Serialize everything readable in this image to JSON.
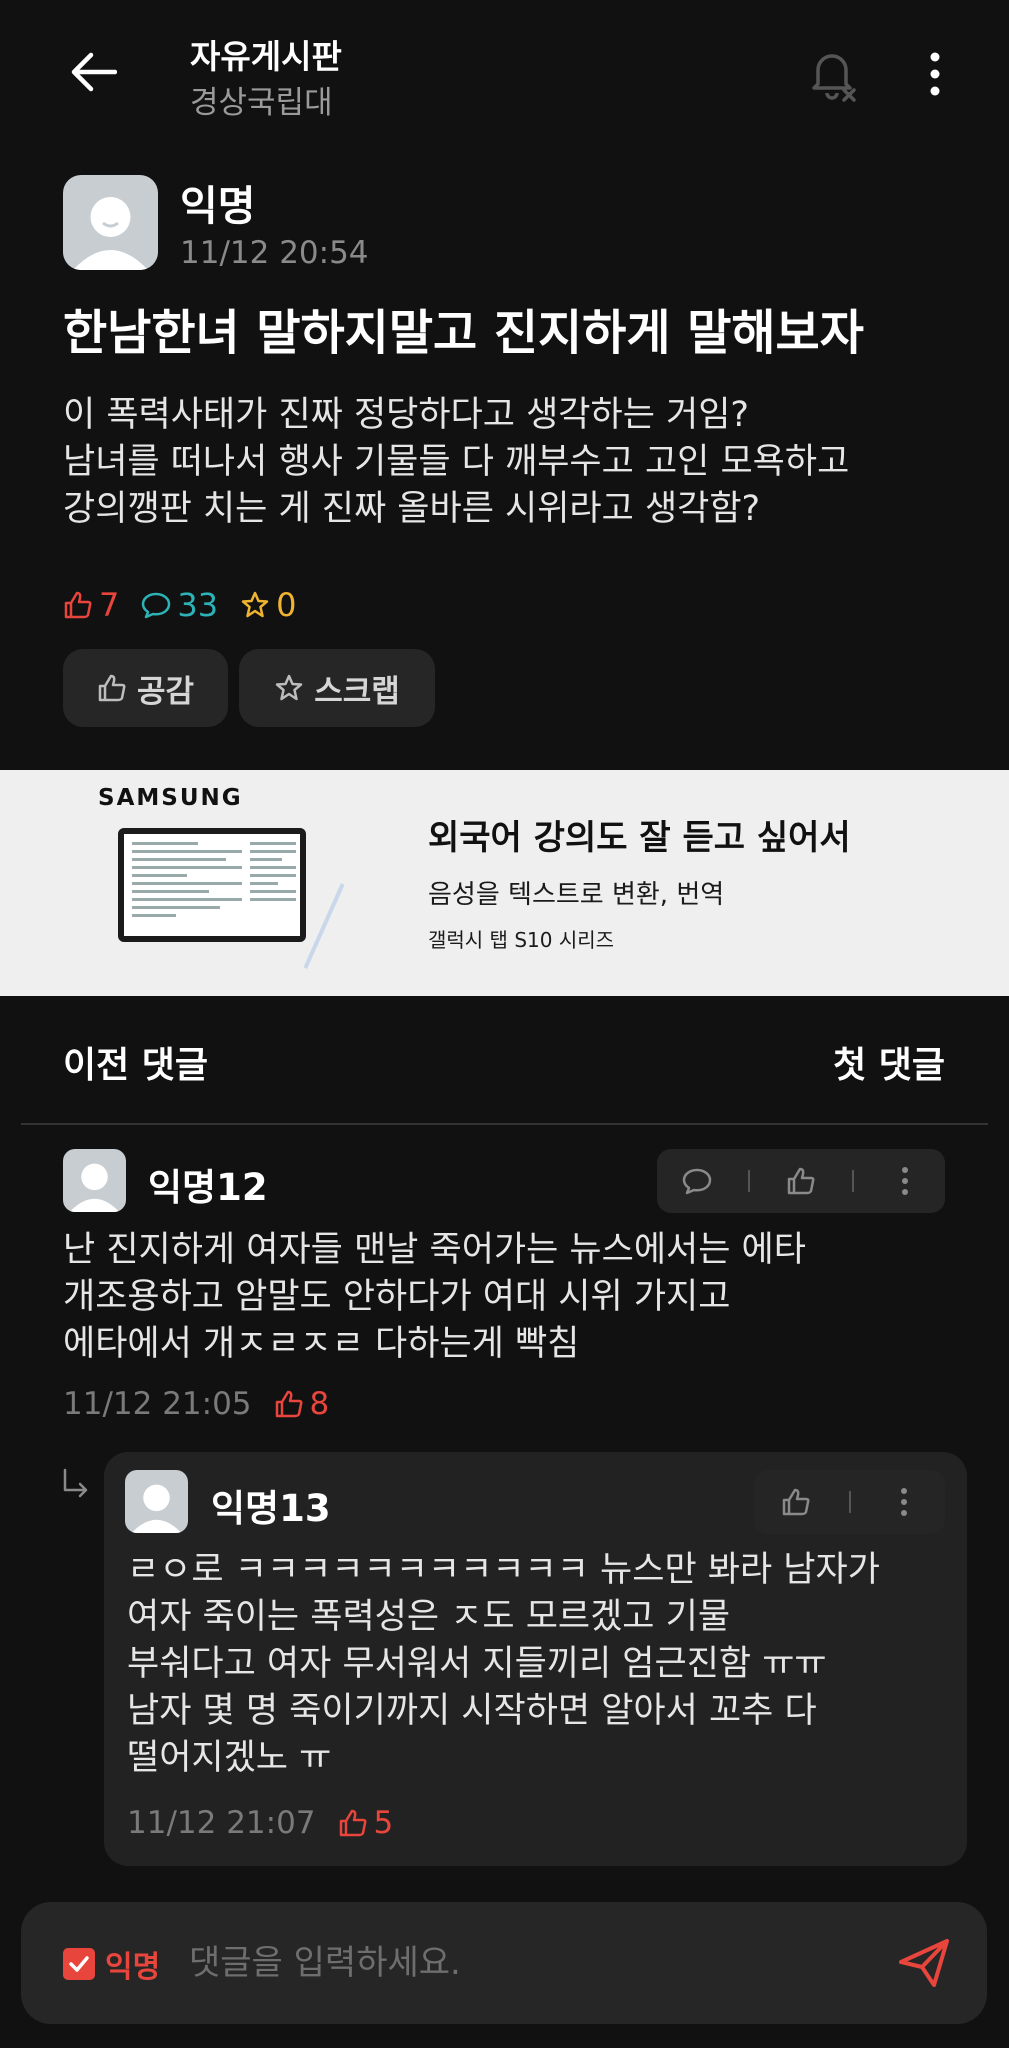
{
  "header": {
    "title": "자유게시판",
    "subtitle": "경상국립대",
    "back_icon": "back-arrow-icon",
    "bell_icon": "bell-off-icon",
    "more_icon": "more-vertical-icon"
  },
  "post": {
    "author": "익명",
    "time": "11/12 20:54",
    "title": "한남한녀 말하지말고 진지하게 말해보자",
    "body_lines": [
      "이 폭력사태가 진짜 정당하다고 생각하는 거임?",
      "남녀를 떠나서 행사 기물들 다 깨부수고 고인 모욕하고",
      "강의깽판 치는 게 진짜 올바른 시위라고 생각함?"
    ],
    "stats": {
      "likes": "7",
      "comments": "33",
      "scraps": "0"
    },
    "buttons": {
      "like": "공감",
      "scrap": "스크랩"
    }
  },
  "ad": {
    "brand": "SAMSUNG",
    "headline": "외국어 강의도 잘 듣고 싶어서",
    "line2": "음성을 텍스트로 변환, 번역",
    "line3": "갤럭시 탭 S10 시리즈"
  },
  "comment_nav": {
    "prev": "이전 댓글",
    "first": "첫 댓글"
  },
  "comments": [
    {
      "author": "익명12",
      "lines": [
        "난 진지하게 여자들 맨날 죽어가는 뉴스에서는 에타",
        "개조용하고 암말도 안하다가 여대 시위 가지고",
        "에타에서 개ㅈㄹㅈㄹ 다하는게 빡침"
      ],
      "time": "11/12 21:05",
      "likes": "8"
    },
    {
      "author": "익명13",
      "lines": [
        "ㄹㅇ로 ㅋㅋㅋㅋㅋㅋㅋㅋㅋㅋㅋ 뉴스만 봐라 남자가",
        "여자 죽이는 폭력성은 ㅈ도 모르겠고 기물",
        "부숴다고 여자 무서워서 지들끼리 엄근진함 ㅠㅠ",
        "남자 몇 명 죽이기까지 시작하면 알아서 꼬추 다",
        "떨어지겠노 ㅠ"
      ],
      "time": "11/12 21:07",
      "likes": "5"
    }
  ],
  "input": {
    "anon_label": "익명",
    "anon_checked": true,
    "placeholder": "댓글을 입력하세요.",
    "value": ""
  },
  "colors": {
    "background": "#111111",
    "accent_red": "#e8453c",
    "comment_teal": "#2cb3b7",
    "scrap_yellow": "#f0b530",
    "muted": "#8a8a8a"
  }
}
